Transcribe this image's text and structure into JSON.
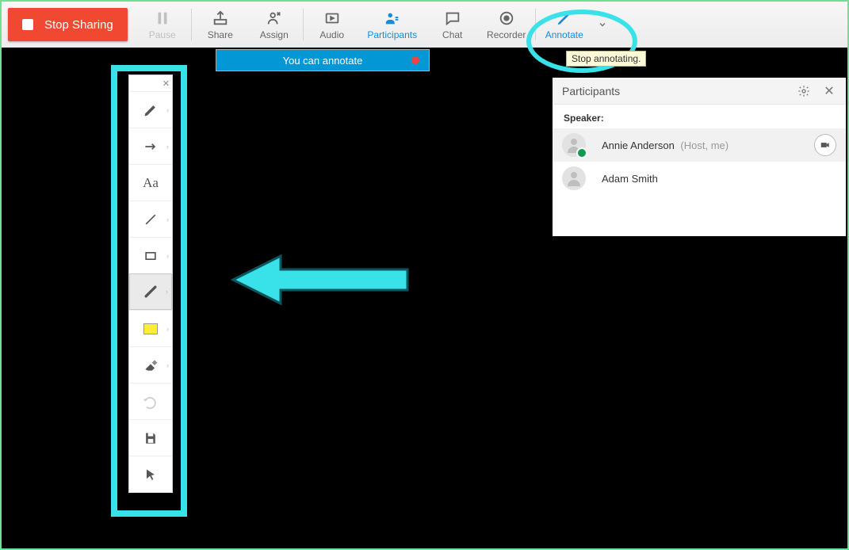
{
  "toolbar": {
    "stop_sharing": "Stop Sharing",
    "pause": "Pause",
    "share": "Share",
    "assign": "Assign",
    "audio": "Audio",
    "participants": "Participants",
    "chat": "Chat",
    "recorder": "Recorder",
    "annotate": "Annotate"
  },
  "tooltip": "Stop annotating.",
  "notif": "You can annotate",
  "participants_panel": {
    "title": "Participants",
    "speaker_label": "Speaker:",
    "rows": [
      {
        "name": "Annie Anderson",
        "sub": "(Host, me)"
      },
      {
        "name": "Adam Smith",
        "sub": ""
      }
    ]
  }
}
